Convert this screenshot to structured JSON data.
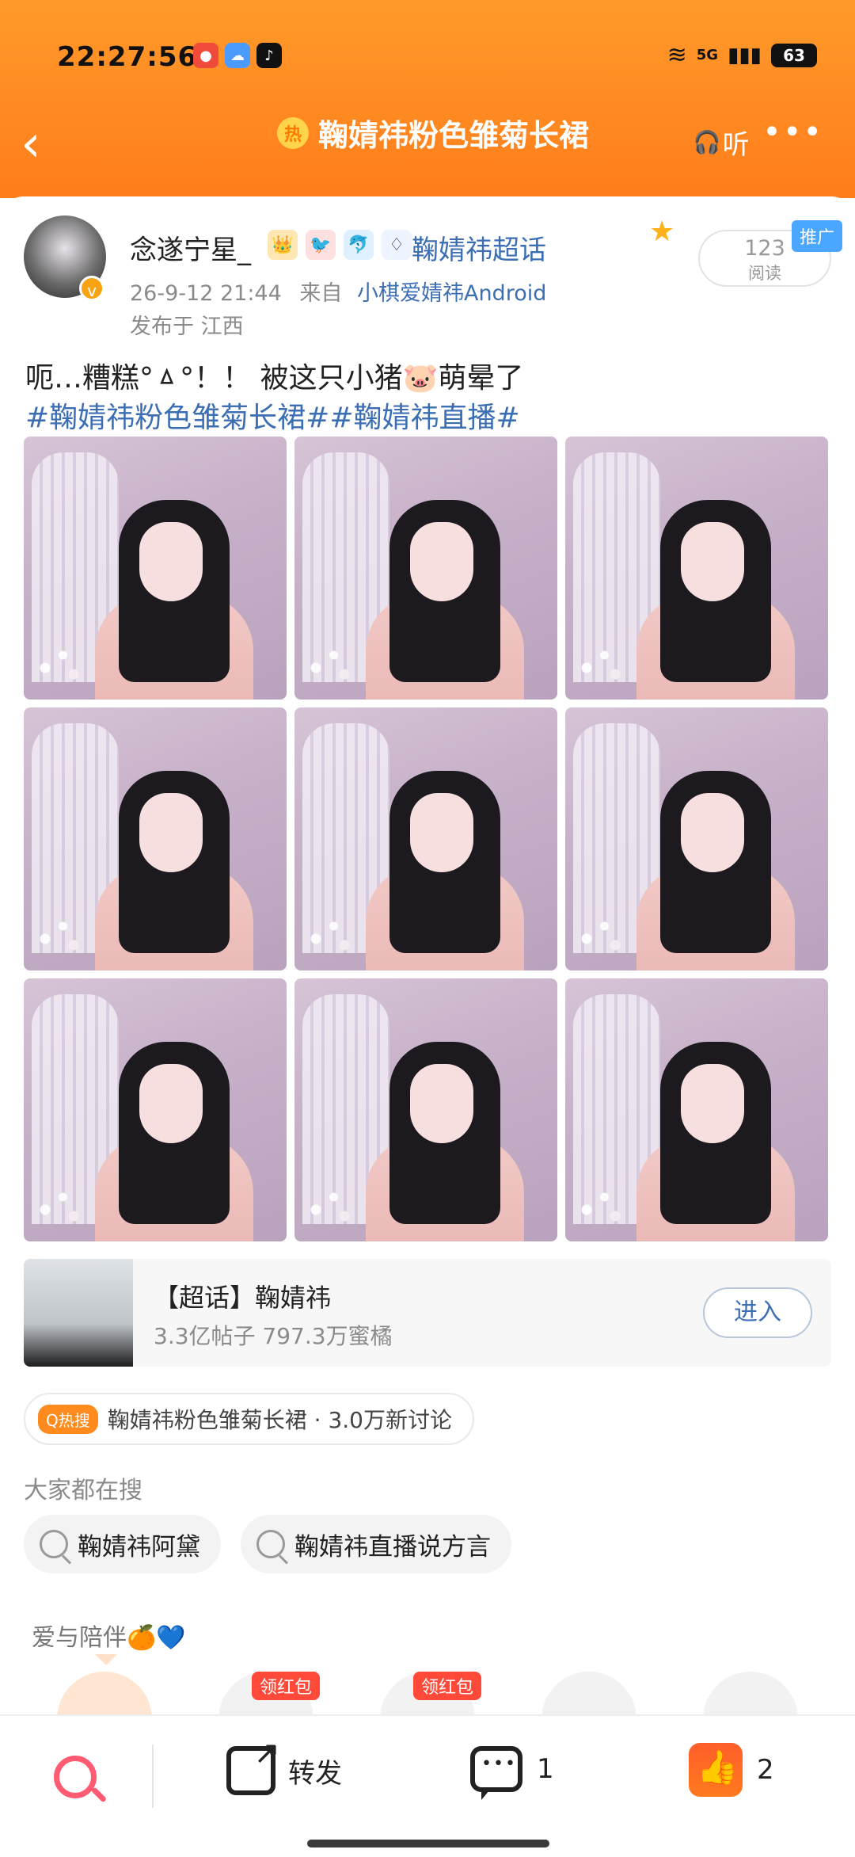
{
  "status_bar": {
    "time": "22:27:56",
    "battery": "63",
    "network": "5G",
    "app_icons": [
      "weibo-icon",
      "weather-icon",
      "tiktok-icon"
    ]
  },
  "nav": {
    "title": "鞠婧祎粉色雏菊长裙",
    "listen_label": "听",
    "hot_mark": "热"
  },
  "post": {
    "username": "念遂宁星_",
    "supertopic_link": "鞠婧祎超话",
    "date": "26-9-12 21:44",
    "from_label": "来自",
    "source": "小棋爱婧祎Android",
    "location": "发布于 江西",
    "read_count": "123",
    "read_label": "阅读",
    "promo_badge": "推广",
    "text_line1": "呃…糟糕°ㅿ°！！ 被这只小猪🐷萌晕了",
    "text_line2": "#鞠婧祎粉色雏菊长裙##鞠婧祎直播#",
    "photos": [
      "photo-1",
      "photo-2",
      "photo-3",
      "photo-4",
      "photo-5",
      "photo-6",
      "photo-7",
      "photo-8",
      "photo-9"
    ]
  },
  "topic_card": {
    "title": "【超话】鞠婧祎",
    "subtitle": "3.3亿帖子 797.3万蜜橘",
    "enter_label": "进入"
  },
  "hot_search": {
    "tag": "Q热搜",
    "text": "鞠婧祎粉色雏菊长裙 · 3.0万新讨论"
  },
  "search_section": {
    "title": "大家都在搜",
    "items": [
      "鞠婧祎阿黛",
      "鞠婧祎直播说方言"
    ]
  },
  "love_section": {
    "title": "爱与陪伴🍊💙",
    "red_tag_1": "领红包",
    "red_tag_2": "领红包"
  },
  "bottom_bar": {
    "share_label": "转发",
    "comment_count": "1",
    "like_count": "2"
  },
  "colors": {
    "header_orange": "#ff8a22",
    "link_blue": "#3c6eb4",
    "muted_gray": "#8a8a8a",
    "red_tag": "#ff4a3a"
  }
}
